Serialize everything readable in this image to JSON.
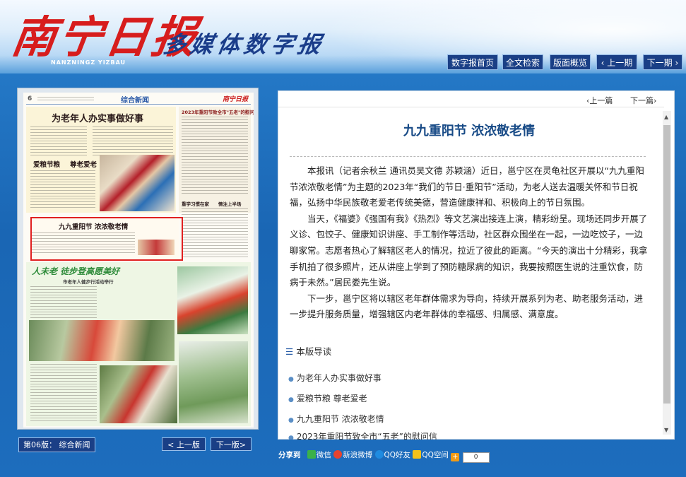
{
  "header": {
    "logo_text": "南宁日报",
    "logo_pinyin": "NANZNINGZ YIZBAU",
    "subtitle": "多媒体数字报"
  },
  "topnav": {
    "home": "数字报首页",
    "search": "全文检索",
    "overview": "版面概览",
    "prev_issue": "上一期",
    "next_issue": "下一期"
  },
  "paper": {
    "page_no": "6",
    "section_header": "综合新闻",
    "headline_main": "为老年人办实事做好事",
    "headline_sub1": "爱粮节粮",
    "headline_sub2": "尊老爱老",
    "headline_highlight": "九九重阳节  浓浓敬老情",
    "right_header": "2023年重阳节致全市\"五老\"的慰问信",
    "headline_lower": "人未老  徒步登高愿美好",
    "lower_deck": "市老年人健步行活动举行",
    "column_a": "重学习惯在家",
    "column_b": "情注上半场"
  },
  "left_footer": {
    "page_label": "第06版：  综合新闻",
    "prev_page": "< 上一版",
    "next_page": "下一版>"
  },
  "article": {
    "prev": "上一篇",
    "next": "下一篇",
    "title": "九九重阳节  浓浓敬老情",
    "paragraphs": [
      "本报讯（记者余秋兰 通讯员吴文德 苏颖涵）近日，邕宁区在灵龟社区开展以“九九重阳节浓浓敬老情”为主题的2023年“我们的节日·重阳节”活动，为老人送去温暖关怀和节日祝福，弘扬中华民族敬老爱老传统美德，营造健康祥和、积极向上的节日氛围。",
      "当天，《福婆》《强国有我》《热烈》等文艺演出接连上演，精彩纷呈。现场还同步开展了义诊、包饺子、健康知识讲座、手工制作等活动，社区群众围坐在一起，一边吃饺子，一边聊家常。志愿者热心了解辖区老人的情况，拉近了彼此的距离。“今天的演出十分精彩，我拿手机拍了很多照片，还从讲座上学到了预防糖尿病的知识，我要按照医生说的注重饮食，防病于未然。”居民娄先生说。",
      "下一步，邕宁区将以辖区老年群体需求为导向，持续开展系列为老、助老服务活动，进一步提升服务质量，增强辖区内老年群体的幸福感、归属感、满意度。"
    ],
    "toc_heading": "本版导读",
    "toc": [
      "为老年人办实事做好事",
      "爱粮节粮 尊老爱老",
      "九九重阳节 浓浓敬老情",
      "2023年重阳节致全市“五老”的慰问信"
    ]
  },
  "share": {
    "label": "分享到",
    "wechat": "微信",
    "weibo": "新浪微博",
    "qq_friend": "QQ好友",
    "qzone": "QQ空间",
    "count": "0"
  },
  "colors": {
    "brand_red": "#d71d1d",
    "nav_blue": "#1a3f86",
    "title_blue": "#174a86",
    "background": "#1e72c0"
  }
}
